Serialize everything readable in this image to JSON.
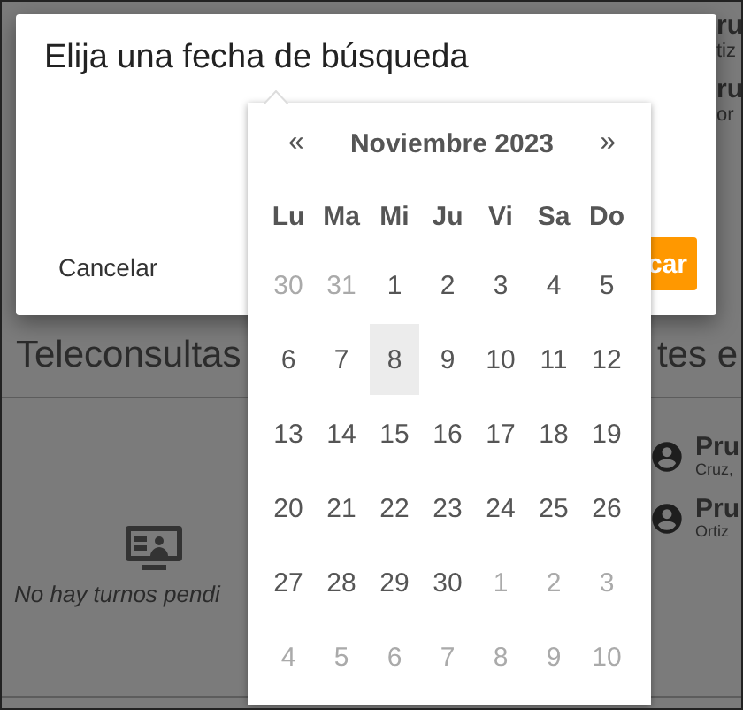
{
  "background": {
    "top_patients": [
      {
        "name": "ru",
        "detail": "tiz"
      },
      {
        "name": "ru",
        "detail": "or"
      }
    ],
    "heading_left": "Teleconsultas",
    "heading_right": "tes e",
    "empty_state": "No hay turnos pendi",
    "patients": [
      {
        "name": "Pru",
        "detail": "Cruz,"
      },
      {
        "name": "Pru",
        "detail": "Ortiz"
      }
    ]
  },
  "dialog": {
    "title": "Elija una fecha de búsqueda",
    "cancel": "Cancelar",
    "confirm": "car"
  },
  "datepicker": {
    "prev": "«",
    "title": "Noviembre 2023",
    "next": "»",
    "weekdays": [
      "Lu",
      "Ma",
      "Mi",
      "Ju",
      "Vi",
      "Sa",
      "Do"
    ],
    "weeks": [
      [
        {
          "day": "30",
          "outside": true,
          "selected": false
        },
        {
          "day": "31",
          "outside": true,
          "selected": false
        },
        {
          "day": "1",
          "outside": false,
          "selected": false
        },
        {
          "day": "2",
          "outside": false,
          "selected": false
        },
        {
          "day": "3",
          "outside": false,
          "selected": false
        },
        {
          "day": "4",
          "outside": false,
          "selected": false
        },
        {
          "day": "5",
          "outside": false,
          "selected": false
        }
      ],
      [
        {
          "day": "6",
          "outside": false,
          "selected": false
        },
        {
          "day": "7",
          "outside": false,
          "selected": false
        },
        {
          "day": "8",
          "outside": false,
          "selected": true
        },
        {
          "day": "9",
          "outside": false,
          "selected": false
        },
        {
          "day": "10",
          "outside": false,
          "selected": false
        },
        {
          "day": "11",
          "outside": false,
          "selected": false
        },
        {
          "day": "12",
          "outside": false,
          "selected": false
        }
      ],
      [
        {
          "day": "13",
          "outside": false,
          "selected": false
        },
        {
          "day": "14",
          "outside": false,
          "selected": false
        },
        {
          "day": "15",
          "outside": false,
          "selected": false
        },
        {
          "day": "16",
          "outside": false,
          "selected": false
        },
        {
          "day": "17",
          "outside": false,
          "selected": false
        },
        {
          "day": "18",
          "outside": false,
          "selected": false
        },
        {
          "day": "19",
          "outside": false,
          "selected": false
        }
      ],
      [
        {
          "day": "20",
          "outside": false,
          "selected": false
        },
        {
          "day": "21",
          "outside": false,
          "selected": false
        },
        {
          "day": "22",
          "outside": false,
          "selected": false
        },
        {
          "day": "23",
          "outside": false,
          "selected": false
        },
        {
          "day": "24",
          "outside": false,
          "selected": false
        },
        {
          "day": "25",
          "outside": false,
          "selected": false
        },
        {
          "day": "26",
          "outside": false,
          "selected": false
        }
      ],
      [
        {
          "day": "27",
          "outside": false,
          "selected": false
        },
        {
          "day": "28",
          "outside": false,
          "selected": false
        },
        {
          "day": "29",
          "outside": false,
          "selected": false
        },
        {
          "day": "30",
          "outside": false,
          "selected": false
        },
        {
          "day": "1",
          "outside": true,
          "selected": false
        },
        {
          "day": "2",
          "outside": true,
          "selected": false
        },
        {
          "day": "3",
          "outside": true,
          "selected": false
        }
      ],
      [
        {
          "day": "4",
          "outside": true,
          "selected": false
        },
        {
          "day": "5",
          "outside": true,
          "selected": false
        },
        {
          "day": "6",
          "outside": true,
          "selected": false
        },
        {
          "day": "7",
          "outside": true,
          "selected": false
        },
        {
          "day": "8",
          "outside": true,
          "selected": false
        },
        {
          "day": "9",
          "outside": true,
          "selected": false
        },
        {
          "day": "10",
          "outside": true,
          "selected": false
        }
      ]
    ]
  }
}
